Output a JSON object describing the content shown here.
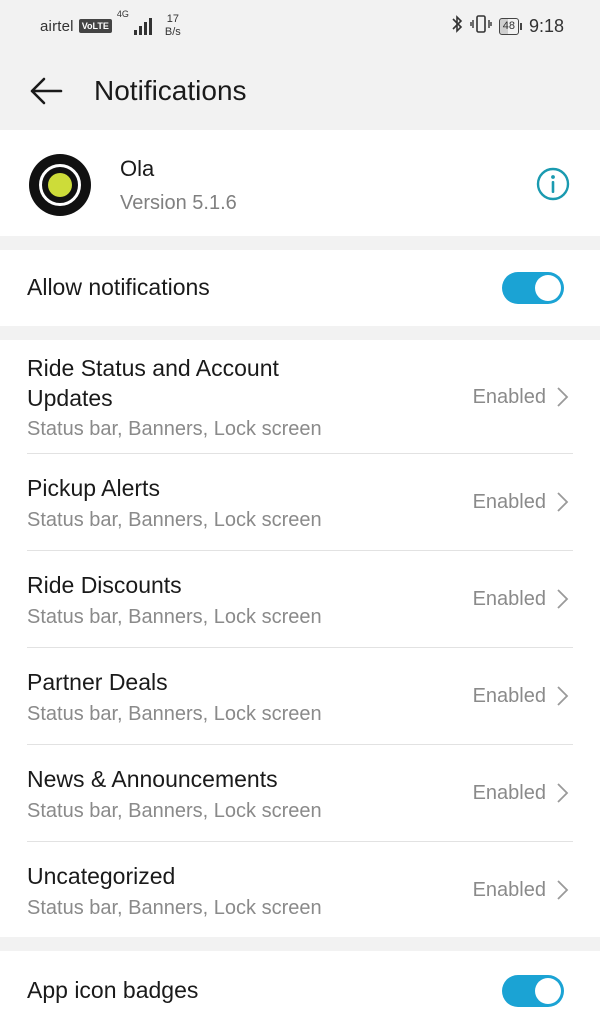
{
  "status_bar": {
    "carrier": "airtel",
    "volte": "VoLTE",
    "network": "4G",
    "speed_value": "17",
    "speed_unit": "B/s",
    "battery": "48",
    "time": "9:18"
  },
  "header": {
    "title": "Notifications",
    "back_icon": "arrow-left-icon"
  },
  "app": {
    "name": "Ola",
    "version": "Version 5.1.6",
    "info_icon": "info-circle-icon"
  },
  "allow_notifications": {
    "label": "Allow notifications",
    "enabled": true
  },
  "channels": [
    {
      "title": "Ride Status and Account Updates",
      "subtitle": "Status bar, Banners, Lock screen",
      "status": "Enabled"
    },
    {
      "title": "Pickup Alerts",
      "subtitle": "Status bar, Banners, Lock screen",
      "status": "Enabled"
    },
    {
      "title": "Ride Discounts",
      "subtitle": "Status bar, Banners, Lock screen",
      "status": "Enabled"
    },
    {
      "title": "Partner Deals",
      "subtitle": "Status bar, Banners, Lock screen",
      "status": "Enabled"
    },
    {
      "title": "News & Announcements",
      "subtitle": "Status bar, Banners, Lock screen",
      "status": "Enabled"
    },
    {
      "title": "Uncategorized",
      "subtitle": "Status bar, Banners, Lock screen",
      "status": "Enabled"
    }
  ],
  "app_icon_badges": {
    "label": "App icon badges",
    "enabled": true
  },
  "colors": {
    "accent": "#1ba3d4",
    "info_icon": "#1a9ab0",
    "logo_dot": "#cddc39"
  }
}
